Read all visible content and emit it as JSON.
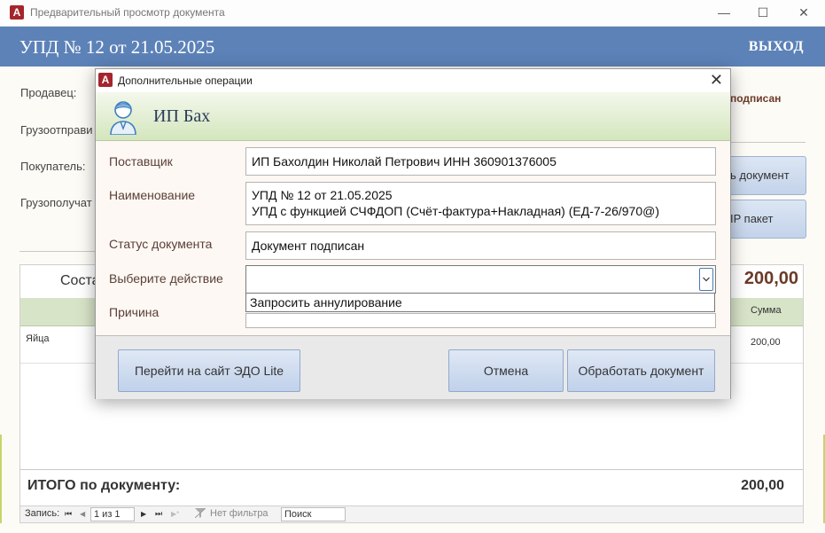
{
  "window": {
    "title": "Предварительный просмотр документа",
    "app_icon_letter": "A",
    "controls": {
      "minimize": "—",
      "maximize": "☐",
      "close": "✕"
    }
  },
  "header": {
    "doc_title": "УПД № 12 от 21.05.2025",
    "exit_label": "ВЫХОД"
  },
  "background": {
    "labels": {
      "seller": "Продавец:",
      "shipper": "Грузоотправи",
      "buyer": "Покупатель:",
      "consignee": "Грузополучат"
    },
    "status_text": "подписан",
    "button_document": "ь документ",
    "button_package": "IP пакет",
    "composition_label": "Соста",
    "total_top": "200,00",
    "sum_header": "Сумма",
    "row": {
      "name": "Яйца",
      "sum": "200,00"
    },
    "itogo_label": "ИТОГО по документу:",
    "itogo_value": "200,00",
    "navbar": {
      "record_label": "Запись:",
      "first": "⏮",
      "prev": "◀",
      "position": "1 из 1",
      "next": "▶",
      "last": "⏭",
      "new": "▶*",
      "filter": "Нет фильтра",
      "search": "Поиск"
    }
  },
  "modal": {
    "caption": "Дополнительные операции",
    "close": "✕",
    "banner_name": "ИП Бах",
    "fields": {
      "supplier_label": "Поставщик",
      "supplier_value": "ИП Бахолдин Николай Петрович  ИНН 360901376005",
      "name_label": "Наименование",
      "name_line1": "УПД № 12 от 21.05.2025",
      "name_line2": "УПД с функцией СЧФДОП (Счёт-фактура+Накладная) (ЕД-7-26/970@)",
      "status_label": "Статус документа",
      "status_value": "Документ подписан",
      "action_label": "Выберите действие",
      "action_value": "",
      "dropdown_option": "Запросить аннулирование",
      "reason_label": "Причина"
    },
    "buttons": {
      "go_site": "Перейти на сайт ЭДО Lite",
      "cancel": "Отмена",
      "process": "Обработать документ"
    }
  }
}
